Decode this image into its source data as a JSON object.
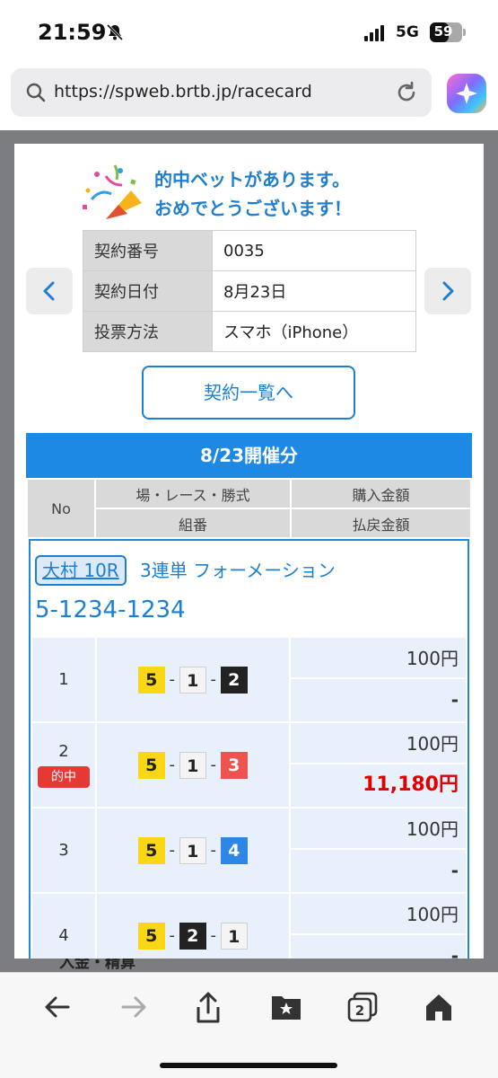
{
  "status_bar": {
    "time": "21:59",
    "network": "5G",
    "battery": "59",
    "battery_level_percent": 59
  },
  "browser": {
    "url": "https://spweb.brtb.jp/racecard"
  },
  "modal": {
    "congrats_line1": "的中ベットがあります。",
    "congrats_line2": "おめでとうございます！",
    "contract": [
      {
        "label": "契約番号",
        "value": "0035"
      },
      {
        "label": "契約日付",
        "value": "8月23日"
      },
      {
        "label": "投票方法",
        "value": "スマホ（iPhone）"
      }
    ],
    "list_button": "契約一覧へ",
    "day_header": "8/23開催分",
    "columns": {
      "no": "No",
      "race": "場・レース・勝式",
      "kumiban": "組番",
      "purchase": "購入金額",
      "payout": "払戻金額"
    },
    "bet": {
      "race": "大村 10R",
      "ticket": "3連単 フォーメーション",
      "combo": "5-1234-1234",
      "hit_label": "的中",
      "rows": [
        {
          "no": "1",
          "nums": [
            "5",
            "1",
            "2"
          ],
          "buy": "100円",
          "pay": "-",
          "hit": false
        },
        {
          "no": "2",
          "nums": [
            "5",
            "1",
            "3"
          ],
          "buy": "100円",
          "pay": "11,180円",
          "hit": true
        },
        {
          "no": "3",
          "nums": [
            "5",
            "1",
            "4"
          ],
          "buy": "100円",
          "pay": "-",
          "hit": false
        },
        {
          "no": "4",
          "nums": [
            "5",
            "2",
            "1"
          ],
          "buy": "100円",
          "pay": "-",
          "hit": false
        }
      ]
    }
  },
  "background_text": "入金・精算",
  "colors": {
    "accent": "#1e7fd0",
    "header_blue": "#1e88e5",
    "hit_red": "#e53935"
  }
}
